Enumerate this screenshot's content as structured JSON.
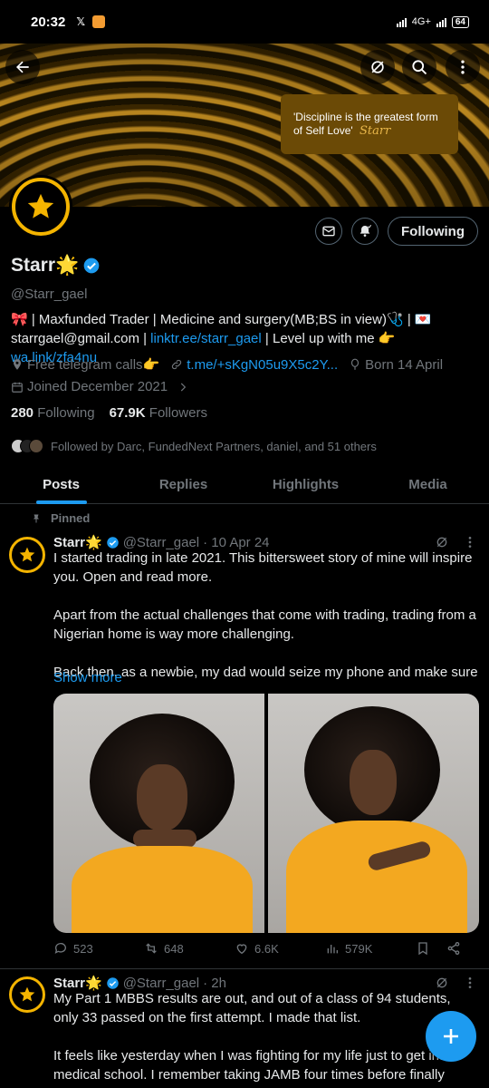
{
  "status_bar": {
    "time": "20:32",
    "network": "4G+",
    "battery": "64"
  },
  "banner": {
    "quote": "'Discipline is the greatest form of Self Love'",
    "signature": "Starr"
  },
  "profile": {
    "name": "Starr🌟",
    "handle": "@Starr_gael",
    "bio_line1": "🎀 | Maxfunded Trader | Medicine and surgery(MB;BS in view)🩺 | 💌",
    "bio_line2_prefix": "starrgael@gmail.com | ",
    "bio_link1": "linktr.ee/starr_gael",
    "bio_line2_mid": " | Level up with me 👉 ",
    "bio_link2": "wa.link/zfa4nu",
    "location": "Free telegram calls👉",
    "telegram_link": "t.me/+sKgN05u9X5c2Y...",
    "birthday": "Born 14 April",
    "joined": "Joined December 2021",
    "following_count": "280",
    "following_label": "Following",
    "followers_count": "67.9K",
    "followers_label": "Followers",
    "followed_by": "Followed by Darc, FundedNext Partners, daniel, and 51 others",
    "follow_button": "Following"
  },
  "tabs": [
    {
      "label": "Posts",
      "active": true
    },
    {
      "label": "Replies",
      "active": false
    },
    {
      "label": "Highlights",
      "active": false
    },
    {
      "label": "Media",
      "active": false
    }
  ],
  "pinned_label": "Pinned",
  "tweet1": {
    "name": "Starr🌟",
    "handle": "@Starr_gael",
    "date": "· 10 Apr 24",
    "p1": "I started trading in late 2021. This bittersweet story of mine will inspire you. Open and read more.",
    "p2": "Apart from the actual challenges that come with trading, trading from a Nigerian home is way more challenging.",
    "p3": "Back then, as a newbie, my dad would seize my phone and make sure",
    "show_more": "Show more",
    "replies": "523",
    "reposts": "648",
    "likes": "6.6K",
    "views": "579K"
  },
  "tweet2": {
    "name": "Starr🌟",
    "handle": "@Starr_gael",
    "date": "· 2h",
    "p1": "My Part 1 MBBS results are out, and out of a class of 94 students, only 33 passed on the first attempt. I made that list.",
    "p2": "It feels like yesterday when I was fighting for my life just to get into medical school. I remember taking JAMB four times before finally getting"
  },
  "colors": {
    "accent": "#1d9bf0",
    "gold": "#f4b400",
    "muted": "#71767b"
  }
}
